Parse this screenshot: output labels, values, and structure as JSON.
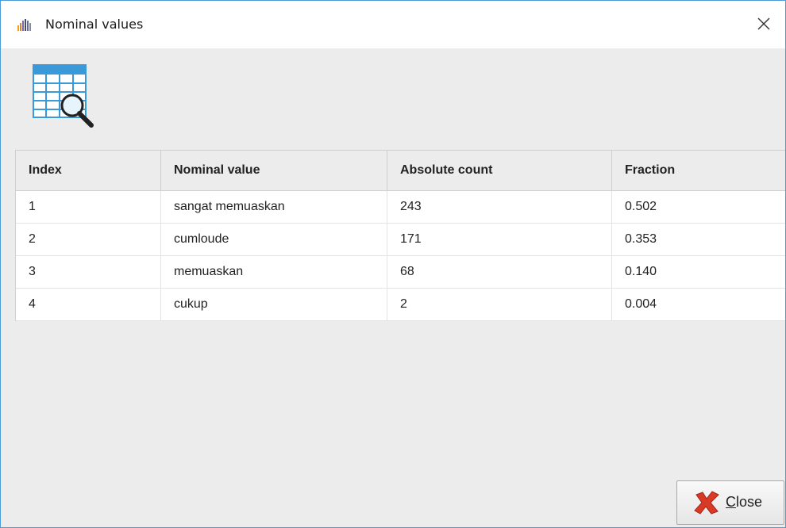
{
  "window": {
    "title": "Nominal values",
    "app_icon": "app-logo-icon",
    "close_icon": "close-icon"
  },
  "header": {
    "icon": "table-search-icon"
  },
  "table": {
    "columns": [
      "Index",
      "Nominal value",
      "Absolute count",
      "Fraction"
    ],
    "rows": [
      [
        "1",
        "sangat memuaskan",
        "243",
        "0.502"
      ],
      [
        "2",
        "cumloude",
        "171",
        "0.353"
      ],
      [
        "3",
        "memuaskan",
        "68",
        "0.140"
      ],
      [
        "4",
        "cukup",
        "2",
        "0.004"
      ]
    ]
  },
  "footer": {
    "close_button": {
      "mnemonic": "C",
      "rest": "lose",
      "icon": "red-x-icon"
    }
  }
}
